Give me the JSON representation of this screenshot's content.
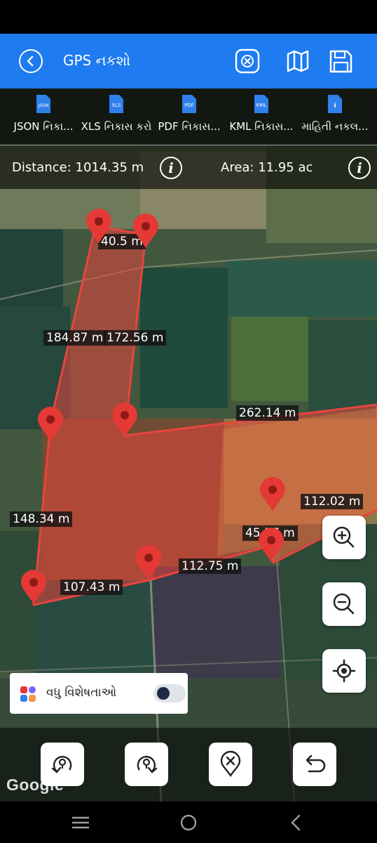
{
  "app_bar": {
    "title": "GPS નકશો",
    "background": "#1e7bf0"
  },
  "exports": [
    {
      "badge": "JSON",
      "label": "JSON નિકા..."
    },
    {
      "badge": "XLS",
      "label": "XLS નિકાસ કરો"
    },
    {
      "badge": "PDF",
      "label": "PDF નિકાસ..."
    },
    {
      "badge": "KML",
      "label": "KML નિકાસ..."
    },
    {
      "badge": "i",
      "label": "માહિતી નકલ..."
    }
  ],
  "measurements": {
    "distance": "Distance: 1014.35 m",
    "area": "Area: 11.95 ac"
  },
  "segments": [
    "40.5 m",
    "184.87 m",
    "172.56 m",
    "262.14 m",
    "112.02 m",
    "148.34 m",
    "45.57 m",
    "112.75 m",
    "107.43 m"
  ],
  "more_features": {
    "label": "વધુ વિશેષતાઓ",
    "toggle_on": false
  },
  "attribution": "Google",
  "colors": {
    "polygon_fill": "#e8453c",
    "pin": "#e53935",
    "accent": "#1e7bf0"
  }
}
